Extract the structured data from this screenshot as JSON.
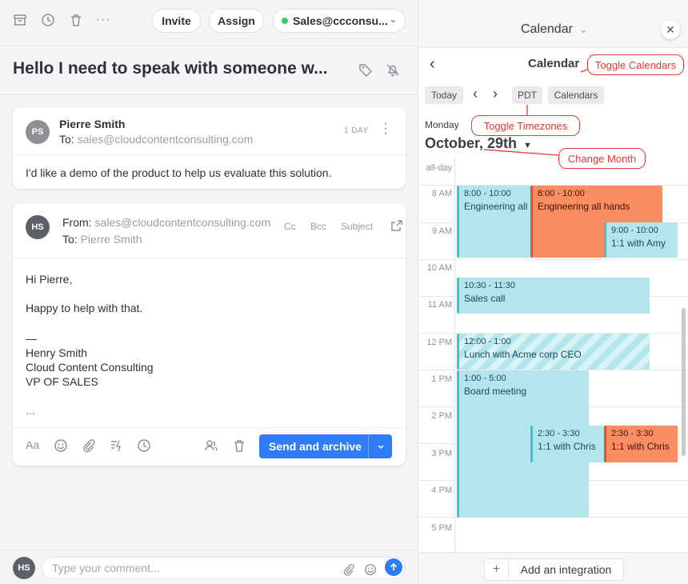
{
  "toolbar": {
    "invite_label": "Invite",
    "assign_label": "Assign",
    "account_label": "Sales@ccconsu...",
    "status_color": "#3cc964",
    "icons": [
      "archive-icon",
      "clock-icon",
      "trash-icon",
      "more-icon"
    ]
  },
  "conversation": {
    "subject": "Hello I need to speak with someone w..."
  },
  "message": {
    "avatar_initials": "PS",
    "avatar_color": "#8e9096",
    "sender": "Pierre Smith",
    "to_label": "To:",
    "to_address": "sales@cloudcontentconsulting.com",
    "age": "1 DAY",
    "body": "I'd like a demo of the product to help us evaluate this solution."
  },
  "reply": {
    "avatar_initials": "HS",
    "avatar_color": "#5c6068",
    "from_label": "From:",
    "from_address": "sales@cloudcontentconsulting.com",
    "to_label": "To:",
    "to_name": "Pierre Smith",
    "cc_label": "Cc",
    "bcc_label": "Bcc",
    "subject_label": "Subject",
    "lines": [
      "Hi Pierre,",
      "Happy to help with that.",
      "—",
      "Henry Smith",
      "Cloud Content Consulting",
      "VP OF SALES",
      "..."
    ],
    "send_label": "Send and archive"
  },
  "comment": {
    "avatar_initials": "HS",
    "placeholder": "Type your comment..."
  },
  "calendar": {
    "panel_title": "Calendar",
    "subtitle": "Calendar",
    "today_label": "Today",
    "timezone_label": "PDT",
    "calendars_label": "Calendars",
    "weekday": "Monday",
    "date": "October, 29th",
    "allday_label": "all-day",
    "hours": [
      "8 AM",
      "9 AM",
      "10 AM",
      "11 AM",
      "12 PM",
      "1 PM",
      "2 PM",
      "3 PM",
      "4 PM",
      "5 PM"
    ],
    "events": [
      {
        "time": "8:00 - 10:00",
        "title": "Engineering all hands",
        "color": "cyan"
      },
      {
        "time": "8:00 - 10:00",
        "title": "Engineering all hands",
        "color": "orange"
      },
      {
        "time": "9:00 - 10:00",
        "title": "1:1 with Amy",
        "color": "cyan"
      },
      {
        "time": "10:30 - 11:30",
        "title": "Sales call",
        "color": "cyan"
      },
      {
        "time": "12:00 - 1:00",
        "title": "Lunch with Acme corp CEO",
        "color": "stripe"
      },
      {
        "time": "1:00 - 5:00",
        "title": "Board meeting",
        "color": "cyan"
      },
      {
        "time": "2:30 - 3:30",
        "title": "1:1 with Chris",
        "color": "cyan"
      },
      {
        "time": "2:30 - 3:30",
        "title": "1:1 with Chris",
        "color": "orange"
      }
    ],
    "integration_label": "Add an integration"
  },
  "annotations": {
    "toggle_calendars": "Toggle Calendars",
    "toggle_timezones": "Toggle Timezones",
    "change_month": "Change Month",
    "color": "#e8372f"
  }
}
